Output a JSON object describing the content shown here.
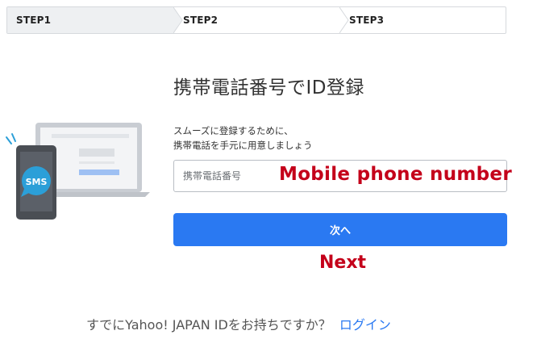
{
  "stepper": {
    "steps": [
      {
        "label": "STEP1",
        "active": true
      },
      {
        "label": "STEP2",
        "active": false
      },
      {
        "label": "STEP3",
        "active": false
      }
    ]
  },
  "illustration": {
    "sms_badge": "SMS"
  },
  "heading": {
    "title": "携帯電話番号でID登録",
    "desc_line1": "スムーズに登録するために、",
    "desc_line2": "携帯電話を手元に用意しましょう"
  },
  "form": {
    "phone_placeholder": "携帯電話番号",
    "phone_value": "",
    "phone_annotation": "Mobile phone number",
    "next_label": "次へ",
    "next_annotation": "Next"
  },
  "footer": {
    "prompt": "すでにYahoo! JAPAN IDをお持ちですか？",
    "login_label": "ログイン"
  },
  "colors": {
    "accent": "#2a79f2",
    "annotation": "#c4001a",
    "step_active_bg": "#eef0f2"
  },
  "icons": {
    "step_separator": "chevron-right-icon",
    "illustration": "phone-laptop-sms-illustration"
  }
}
